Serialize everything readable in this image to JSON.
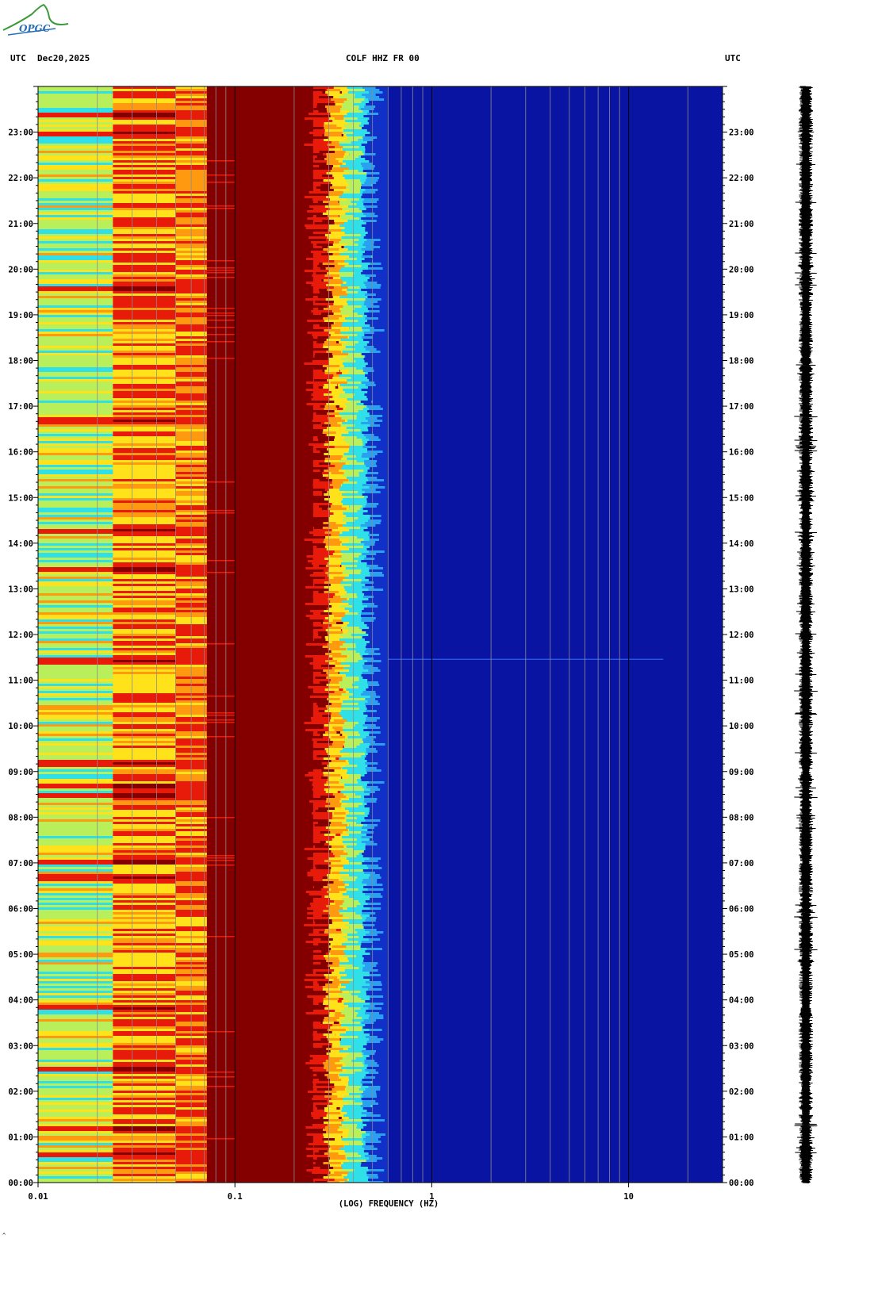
{
  "header": {
    "left_tz": "UTC",
    "date": "Dec20,2025",
    "station": "COLF HHZ FR 00",
    "right_tz": "UTC"
  },
  "logo": {
    "text": "OPGC"
  },
  "colors": {
    "cyan": "#2fe0e8",
    "green_yellow": "#b8ef5a",
    "yellow": "#ffe21a",
    "orange": "#ff9a10",
    "red": "#e81a0a",
    "dark_red": "#840000",
    "blue": "#1030c8",
    "navy": "#0a14a2",
    "grid": "#8c8c8c"
  },
  "chart_data": {
    "type": "heatmap",
    "title": "COLF HHZ FR 00",
    "xlabel": "(LOG) FREQUENCY (HZ)",
    "x_scale": "log",
    "xlim": [
      0.01,
      30
    ],
    "x_ticks": [
      {
        "value": 0.01,
        "label": "0.01"
      },
      {
        "value": 0.1,
        "label": "0.1"
      },
      {
        "value": 1,
        "label": "1"
      },
      {
        "value": 10,
        "label": "10"
      }
    ],
    "y_unit": "UTC",
    "ylim": [
      "00:00",
      "24:00"
    ],
    "y_ticks": [
      "00:00",
      "01:00",
      "02:00",
      "03:00",
      "04:00",
      "05:00",
      "06:00",
      "07:00",
      "08:00",
      "09:00",
      "10:00",
      "11:00",
      "12:00",
      "13:00",
      "14:00",
      "15:00",
      "16:00",
      "17:00",
      "18:00",
      "19:00",
      "20:00",
      "21:00",
      "22:00",
      "23:00"
    ],
    "frequency_bands": [
      {
        "f_start": 0.01,
        "f_end": 0.024,
        "color": "green_yellow"
      },
      {
        "f_start": 0.024,
        "f_end": 0.05,
        "color": "yellow"
      },
      {
        "f_start": 0.05,
        "f_end": 0.072,
        "color": "orange"
      },
      {
        "f_start": 0.072,
        "f_end": 0.1,
        "color": "dark_red"
      },
      {
        "f_start": 0.1,
        "f_end": 0.25,
        "color": "dark_red"
      },
      {
        "f_start": 0.25,
        "f_end": 0.3,
        "color": "red"
      },
      {
        "f_start": 0.3,
        "f_end": 0.38,
        "color": "yellow"
      },
      {
        "f_start": 0.38,
        "f_end": 0.5,
        "color": "cyan"
      },
      {
        "f_start": 0.5,
        "f_end": 0.6,
        "color": "blue"
      },
      {
        "f_start": 0.6,
        "f_end": 30,
        "color": "navy"
      }
    ],
    "strong_events_hours": [
      0.65,
      1.2,
      2.5,
      3.85,
      6.7,
      7.05,
      8.5,
      8.7,
      9.2,
      11.45,
      13.45,
      14.3,
      16.7,
      19.6,
      23.0,
      23.4
    ],
    "seismogram_trace": "continuous noise, Dec20,2025 00:00-24:00"
  }
}
